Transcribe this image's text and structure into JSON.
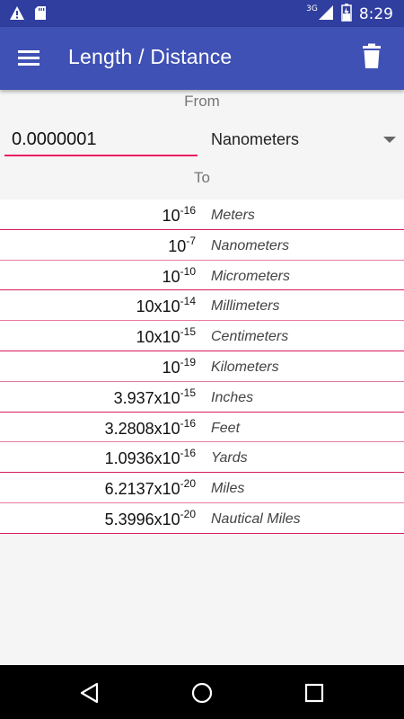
{
  "status_bar": {
    "network": "3G",
    "time": "8:29",
    "icons": [
      "warning-icon",
      "sd-card-icon",
      "signal-icon",
      "battery-icon"
    ]
  },
  "app_bar": {
    "title": "Length / Distance",
    "menu_icon": "hamburger-menu-icon",
    "delete_icon": "trash-icon"
  },
  "converter": {
    "from_label": "From",
    "input_value": "0.0000001",
    "selected_unit": "Nanometers",
    "to_label": "To"
  },
  "results": [
    {
      "mantissa": "",
      "exponent": "-16",
      "unit": "Meters"
    },
    {
      "mantissa": "",
      "exponent": "-7",
      "unit": "Nanometers"
    },
    {
      "mantissa": "",
      "exponent": "-10",
      "unit": "Micrometers"
    },
    {
      "mantissa": "10x",
      "exponent": "-14",
      "unit": "Millimeters"
    },
    {
      "mantissa": "10x",
      "exponent": "-15",
      "unit": "Centimeters"
    },
    {
      "mantissa": "",
      "exponent": "-19",
      "unit": "Kilometers"
    },
    {
      "mantissa": "3.937x",
      "exponent": "-15",
      "unit": "Inches"
    },
    {
      "mantissa": "3.2808x",
      "exponent": "-16",
      "unit": "Feet"
    },
    {
      "mantissa": "1.0936x",
      "exponent": "-16",
      "unit": "Yards"
    },
    {
      "mantissa": "6.2137x",
      "exponent": "-20",
      "unit": "Miles"
    },
    {
      "mantissa": "5.3996x",
      "exponent": "-20",
      "unit": "Nautical Miles"
    }
  ],
  "nav_bar": {
    "icons": [
      "back-icon",
      "home-icon",
      "recents-icon"
    ]
  },
  "colors": {
    "status_bar": "#303F9F",
    "app_bar": "#3F51B5",
    "accent": "#E91E63"
  }
}
